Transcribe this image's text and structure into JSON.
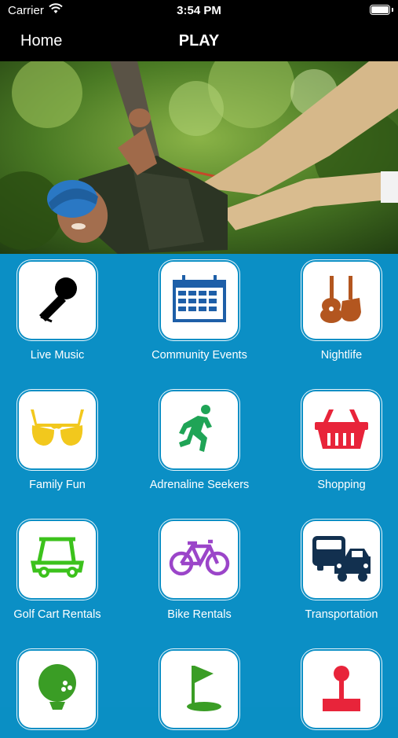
{
  "status_bar": {
    "carrier": "Carrier",
    "time": "3:54 PM"
  },
  "nav": {
    "back_label": "Home",
    "title": "PLAY"
  },
  "hero": {
    "icon": "zipline-photo"
  },
  "tiles": [
    {
      "label": "Live Music",
      "icon": "microphone-icon",
      "color": "#000000"
    },
    {
      "label": "Community Events",
      "icon": "calendar-icon",
      "color": "#1e5fa8"
    },
    {
      "label": "Nightlife",
      "icon": "guitars-icon",
      "color": "#b3561f"
    },
    {
      "label": "Family Fun",
      "icon": "sunglasses-icon",
      "color": "#f2c81d"
    },
    {
      "label": "Adrenaline Seekers",
      "icon": "runner-icon",
      "color": "#1fa456"
    },
    {
      "label": "Shopping",
      "icon": "shopping-basket-icon",
      "color": "#e8243a"
    },
    {
      "label": "Golf Cart Rentals",
      "icon": "golf-cart-icon",
      "color": "#3cc21c"
    },
    {
      "label": "Bike Rentals",
      "icon": "bicycle-icon",
      "color": "#9b45c9"
    },
    {
      "label": "Transportation",
      "icon": "vehicles-icon",
      "color": "#12304f"
    },
    {
      "label": "",
      "icon": "golf-ball-icon",
      "color": "#3a9d25"
    },
    {
      "label": "",
      "icon": "golf-flag-icon",
      "color": "#3a9d25"
    },
    {
      "label": "",
      "icon": "joystick-icon",
      "color": "#e8243a"
    }
  ]
}
